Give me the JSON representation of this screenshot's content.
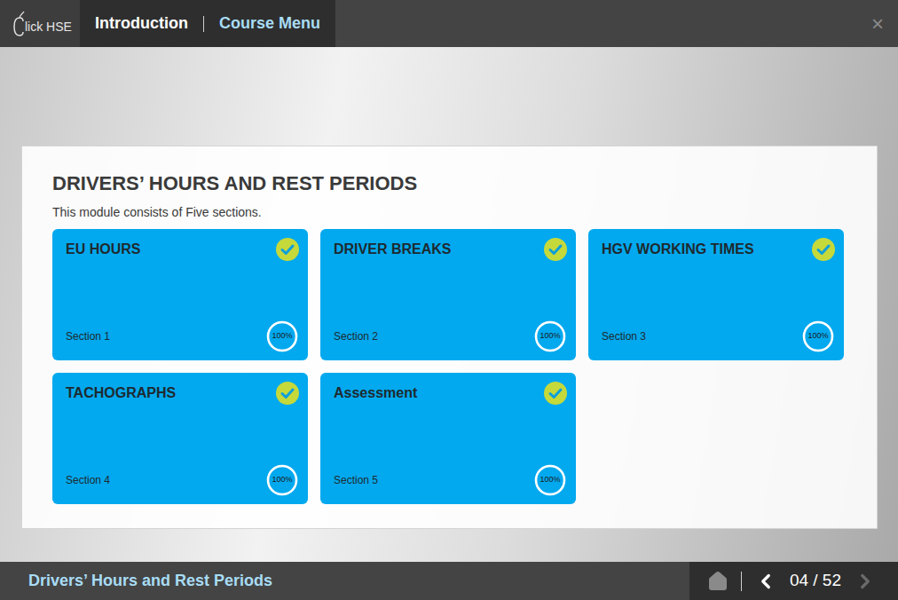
{
  "header": {
    "logo_text": "lick HSE",
    "tabs": [
      {
        "label": "Introduction",
        "selected": true
      },
      {
        "label": "Course Menu",
        "selected": false
      }
    ],
    "close": "×"
  },
  "module": {
    "title": "DRIVERS’ HOURS AND REST PERIODS",
    "subtitle": "This module consists of Five sections."
  },
  "sections": [
    {
      "title": "EU HOURS",
      "section": "Section 1",
      "progress": "100%",
      "level": 1,
      "completed": true
    },
    {
      "title": "DRIVER BREAKS",
      "section": "Section 2",
      "progress": "100%",
      "level": 1,
      "completed": true
    },
    {
      "title": "HGV WORKING TIMES",
      "section": "Section 3",
      "progress": "100%",
      "level": 1,
      "completed": true
    },
    {
      "title": "TACHOGRAPHS",
      "section": "Section 4",
      "progress": "100%",
      "level": 1,
      "completed": true
    },
    {
      "title": "Assessment",
      "section": "Section 5",
      "progress": "100%",
      "level": 1,
      "completed": true
    }
  ],
  "footer": {
    "title": "Drivers’ Hours and Rest Periods",
    "page": "04 / 52",
    "prev_disabled": false,
    "next_disabled": true
  }
}
